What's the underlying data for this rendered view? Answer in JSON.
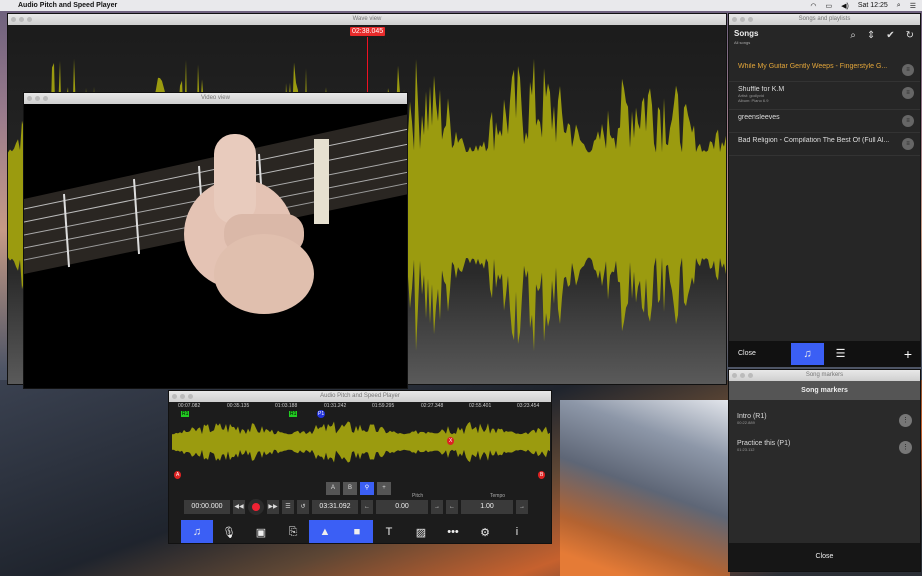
{
  "menubar": {
    "app_name": "Audio Pitch and Speed Player",
    "clock": "Sat 12:25"
  },
  "wave_view": {
    "title": "Wave view",
    "time_marker": "02:38.045"
  },
  "video_view": {
    "title": "Video view"
  },
  "songs": {
    "window_title": "Songs and playlists",
    "heading": "Songs",
    "subheading": "All songs",
    "items": [
      {
        "name": "While My Guitar Gently Weeps - Fingerstyle G...",
        "sub": "",
        "active": true
      },
      {
        "name": "Shuffle for K.M",
        "sub": "Artist: godlyvid",
        "sub2": "Album: Piano 6.9",
        "active": false
      },
      {
        "name": "greensleeves",
        "sub": "",
        "active": false
      },
      {
        "name": "Bad Religion - Compilation The Best Of (Full Al...",
        "sub": "",
        "active": false
      }
    ],
    "close_label": "Close"
  },
  "markers": {
    "window_title": "Song markers",
    "heading": "Song markers",
    "items": [
      {
        "name": "Intro (R1)",
        "time": "00:22.889"
      },
      {
        "name": "Practice this (P1)",
        "time": "01:23.112"
      }
    ],
    "close_label": "Close"
  },
  "player": {
    "title": "Audio Pitch and Speed Player",
    "ruler": [
      "00:07.082",
      "00:35.135",
      "01:03.188",
      "01:31.242",
      "01:59.295",
      "02:27.348",
      "02:55.401",
      "03:23.454"
    ],
    "marker_labels": {
      "r1a": "R1",
      "r1b": "R1",
      "p1": "P1",
      "a": "A",
      "b": "B",
      "x": "X"
    },
    "ab": {
      "a": "A",
      "b": "B"
    },
    "position": "00:00.000",
    "duration": "03:31.092",
    "pitch_label": "Pitch",
    "pitch_value": "0.00",
    "tempo_label": "Tempo",
    "tempo_value": "1.00"
  },
  "colors": {
    "accent": "#3b5ff5",
    "waveform": "#9b9b0f",
    "record": "#e22233",
    "highlight": "#e2a53a"
  }
}
